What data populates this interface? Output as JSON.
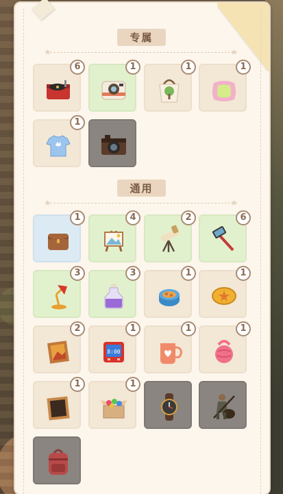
{
  "sections": {
    "exclusive": {
      "title": "专属",
      "items": [
        {
          "name": "record-player",
          "count": "6",
          "bg": "tan"
        },
        {
          "name": "instant-camera",
          "count": "1",
          "bg": "green"
        },
        {
          "name": "tote-bag",
          "count": "1",
          "bg": "tan"
        },
        {
          "name": "pillow",
          "count": "1",
          "bg": "tan"
        },
        {
          "name": "t-shirt",
          "count": "1",
          "bg": "tan"
        },
        {
          "name": "vintage-camera",
          "count": "",
          "bg": "gray"
        }
      ]
    },
    "general": {
      "title": "通用",
      "items": [
        {
          "name": "leather-pouch",
          "count": "1",
          "bg": "blue"
        },
        {
          "name": "easel",
          "count": "4",
          "bg": "green"
        },
        {
          "name": "telescope",
          "count": "2",
          "bg": "green"
        },
        {
          "name": "selfie-stick",
          "count": "6",
          "bg": "green"
        },
        {
          "name": "desk-lamp",
          "count": "3",
          "bg": "green"
        },
        {
          "name": "potion-bottle",
          "count": "3",
          "bg": "green"
        },
        {
          "name": "cookie-tin",
          "count": "1",
          "bg": "tan"
        },
        {
          "name": "coin",
          "count": "1",
          "bg": "tan"
        },
        {
          "name": "picture-frame",
          "count": "2",
          "bg": "tan"
        },
        {
          "name": "digital-clock",
          "count": "1",
          "bg": "tan"
        },
        {
          "name": "heart-mug",
          "count": "1",
          "bg": "tan"
        },
        {
          "name": "kettlebell",
          "count": "1",
          "bg": "tan"
        },
        {
          "name": "chalkboard",
          "count": "1",
          "bg": "tan"
        },
        {
          "name": "candy-box",
          "count": "1",
          "bg": "tan"
        },
        {
          "name": "wristwatch",
          "count": "",
          "bg": "gray"
        },
        {
          "name": "guitar-figure",
          "count": "",
          "bg": "gray"
        },
        {
          "name": "backpack",
          "count": "",
          "bg": "gray"
        }
      ]
    }
  }
}
